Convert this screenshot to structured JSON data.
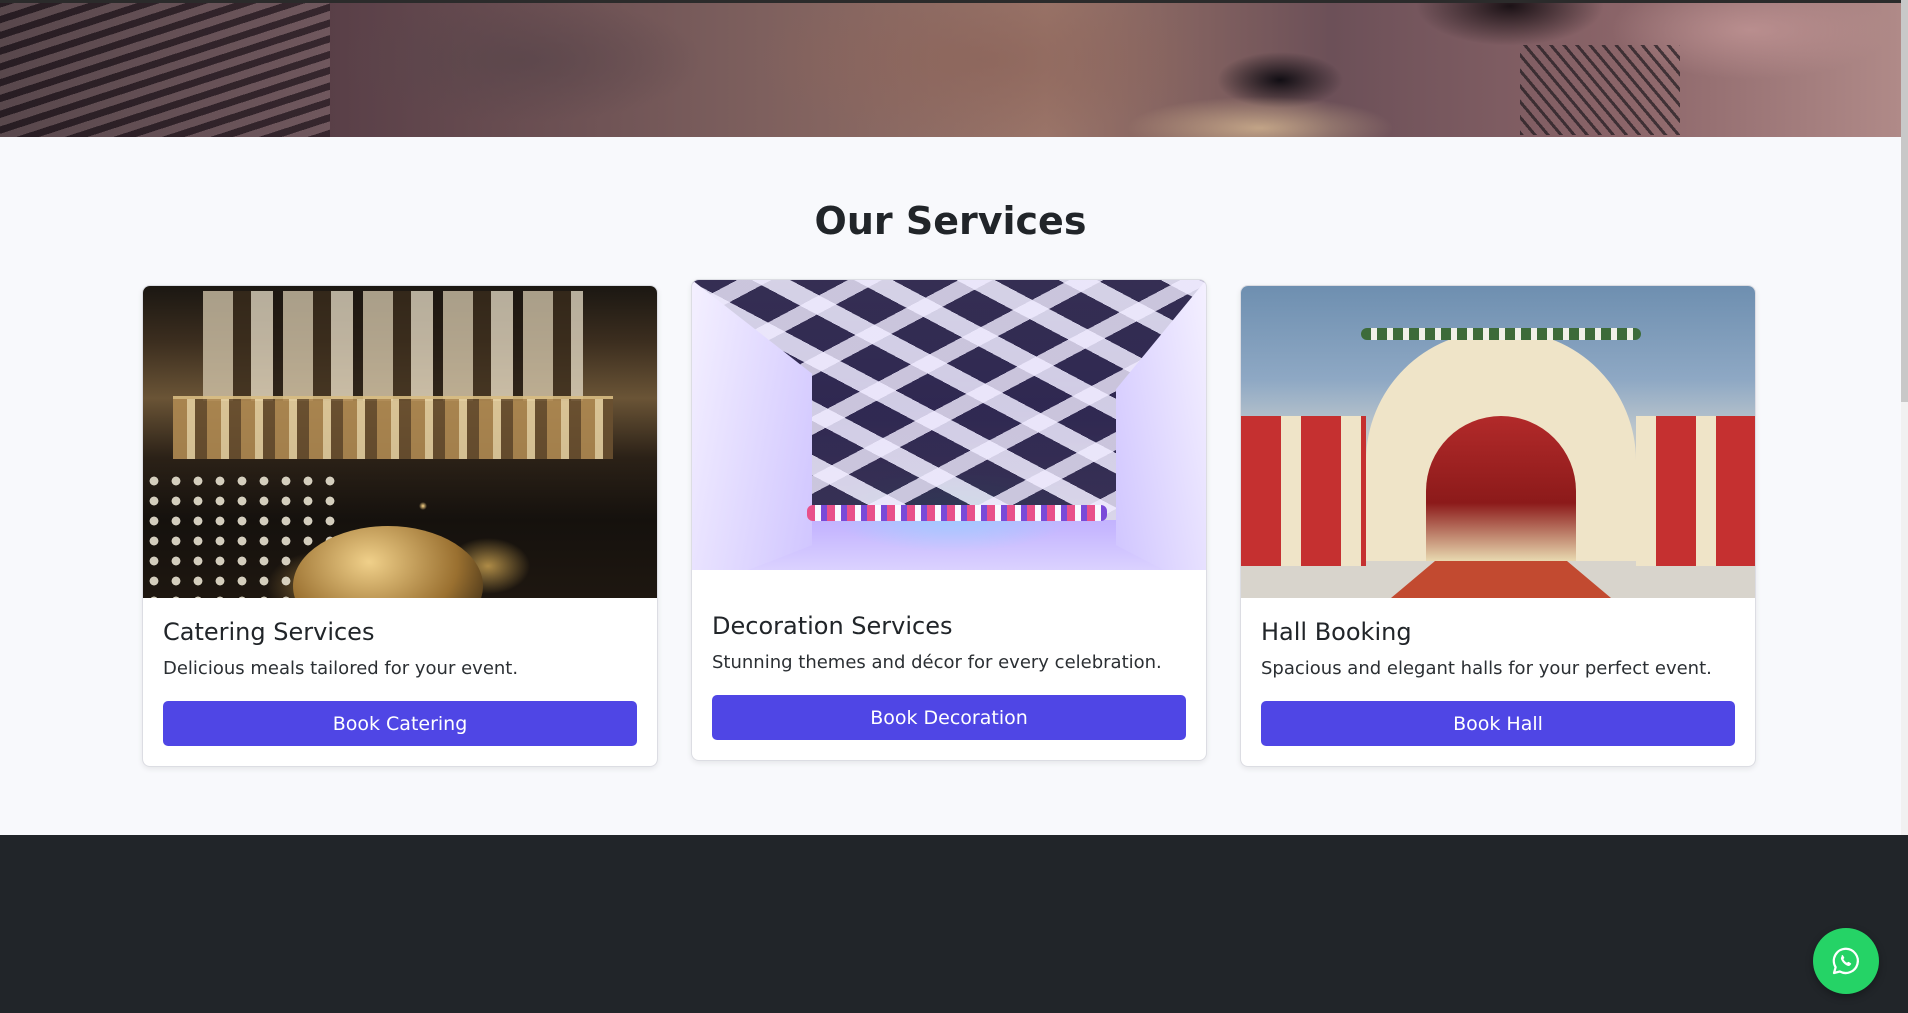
{
  "services_section": {
    "title": "Our Services",
    "cards": [
      {
        "title": "Catering Services",
        "description": "Delicious meals tailored for your event.",
        "button_label": "Book Catering"
      },
      {
        "title": "Decoration Services",
        "description": "Stunning themes and décor for every celebration.",
        "button_label": "Book Decoration"
      },
      {
        "title": "Hall Booking",
        "description": "Spacious and elegant halls for your perfect event.",
        "button_label": "Book Hall"
      }
    ]
  },
  "floating_action": {
    "icon": "whatsapp-icon"
  },
  "colors": {
    "accent": "#4f46e5",
    "section_bg": "#f8f9fc",
    "footer_bg": "#212529",
    "whatsapp": "#25d366"
  }
}
